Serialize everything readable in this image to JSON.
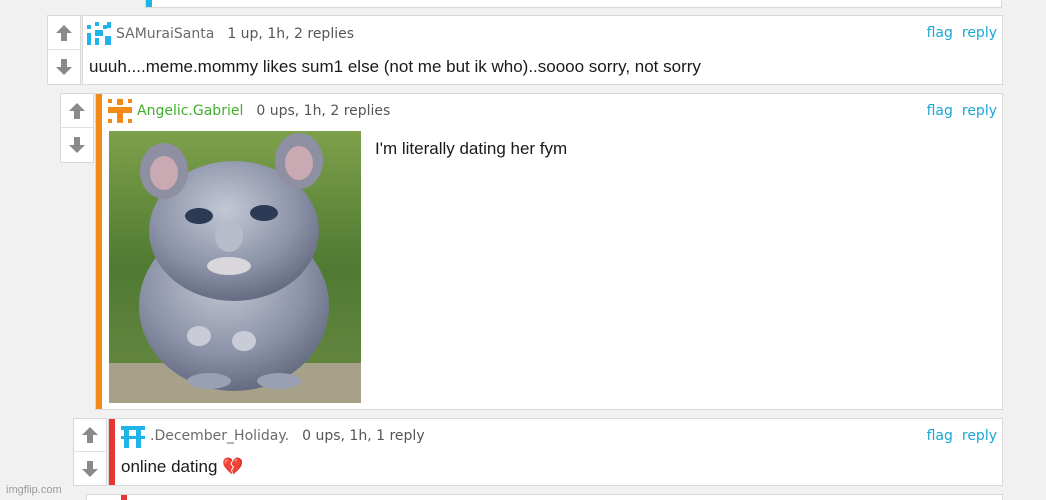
{
  "comments": [
    {
      "username": "SAMuraiSanta",
      "meta": "1 up, 1h, 2 replies",
      "text": "uuuh....meme.mommy likes sum1 else (not me but ik who)..soooo sorry, not sorry",
      "avatar_color": "#1fb5e8",
      "stripe_color": ""
    },
    {
      "username": "Angelic.Gabriel",
      "meta": "0 ups, 1h, 2 replies",
      "text": "I'm literally dating her fym",
      "avatar_color": "#f28a1a",
      "stripe_color": "#f28a1a",
      "image_name": "chinchilla-photo"
    },
    {
      "username": ".December_Holiday.",
      "meta": "0 ups, 1h, 1 reply",
      "text": "online dating 💔",
      "avatar_color": "#1fb5e8",
      "stripe_color": "#e53535"
    }
  ],
  "actions": {
    "flag": "flag",
    "reply": "reply"
  },
  "icons": {
    "upvote": "arrow-up-icon",
    "downvote": "arrow-down-icon"
  },
  "watermark": "imgflip.com"
}
